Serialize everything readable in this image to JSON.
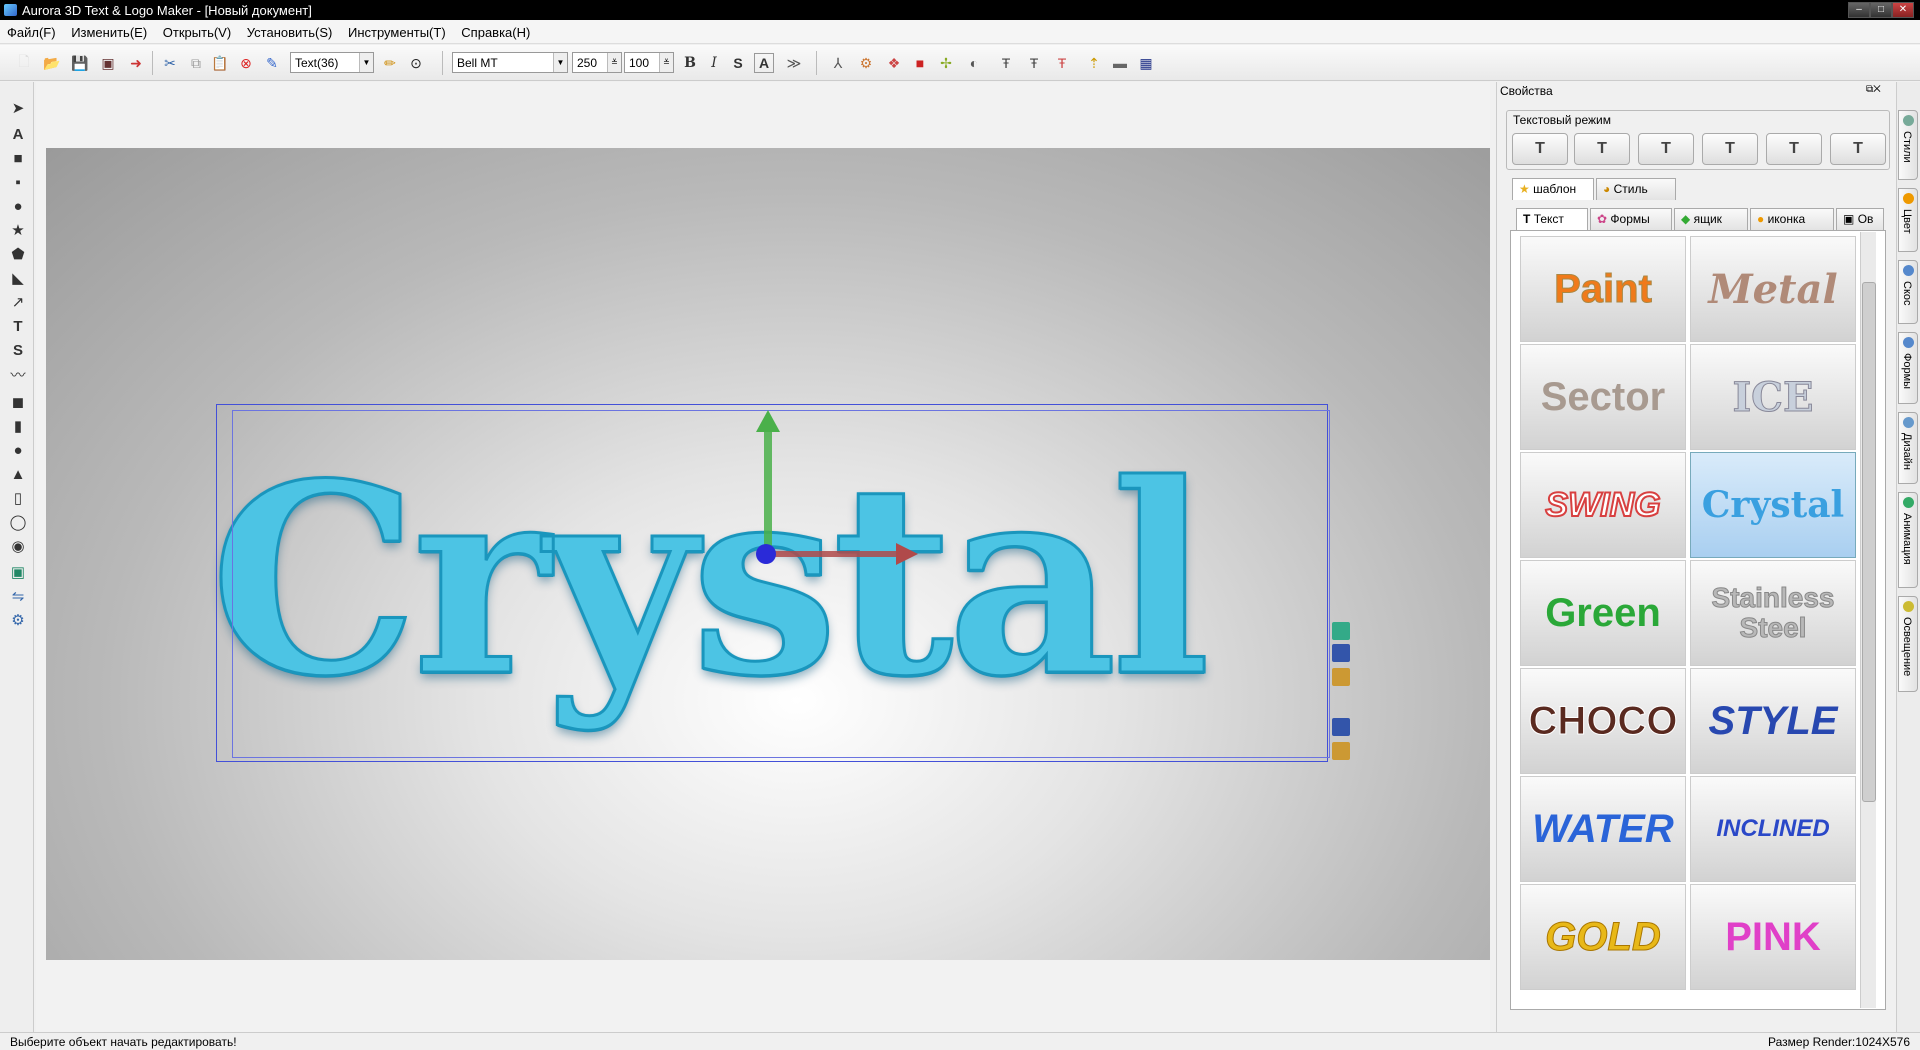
{
  "window": {
    "title": "Aurora 3D Text & Logo Maker - [Новый документ]"
  },
  "menu": [
    "Файл(F)",
    "Изменить(E)",
    "Открыть(V)",
    "Установить(S)",
    "Инструменты(T)",
    "Справка(H)"
  ],
  "toolbar": {
    "object_combo": "Text(36)",
    "font_combo": "Bell MT",
    "size_value": "250",
    "scale_value": "100",
    "bold": "B",
    "italic": "I",
    "strike": "S",
    "outline": "A"
  },
  "canvas": {
    "text": "Crystal",
    "text_color": "#4cc4e4"
  },
  "panel": {
    "title": "Свойства",
    "mode_group_label": "Текстовый режим",
    "mode_buttons": [
      "T",
      "T",
      "T",
      "T",
      "T",
      "T"
    ],
    "top_tabs": [
      "шаблон",
      "Стиль"
    ],
    "category_tabs": [
      "Текст",
      "Формы",
      "ящик",
      "иконка",
      "Ов"
    ],
    "styles": [
      {
        "label": "Paint",
        "color": "#f07a1a"
      },
      {
        "label": "Metal",
        "color": "#b08a78"
      },
      {
        "label": "Sector",
        "color": "#a89a90"
      },
      {
        "label": "ICE",
        "color": "#c8d0dc"
      },
      {
        "label": "SWING",
        "color": "#d84040"
      },
      {
        "label": "Crystal",
        "color": "#3aa0e0"
      },
      {
        "label": "Green",
        "color": "#2aa838"
      },
      {
        "label": "Stainless Steel",
        "color": "#b8b8b8"
      },
      {
        "label": "CHOCO",
        "color": "#5a2a20"
      },
      {
        "label": "STYLE",
        "color": "#2848b0"
      },
      {
        "label": "WATER",
        "color": "#2a64d8"
      },
      {
        "label": "INCLINED",
        "color": "#2a48c8"
      },
      {
        "label": "GOLD",
        "color": "#e8b818"
      },
      {
        "label": "PINK",
        "color": "#e040c8"
      }
    ],
    "selected_style": "Crystal"
  },
  "side_tabs": [
    "Стили",
    "Цвет",
    "Скос",
    "Формы",
    "Дизайн",
    "Анимация",
    "Освещение"
  ],
  "status": {
    "left": "Выберите объект начать редактировать!",
    "right": "Размер Render:1024X576"
  }
}
